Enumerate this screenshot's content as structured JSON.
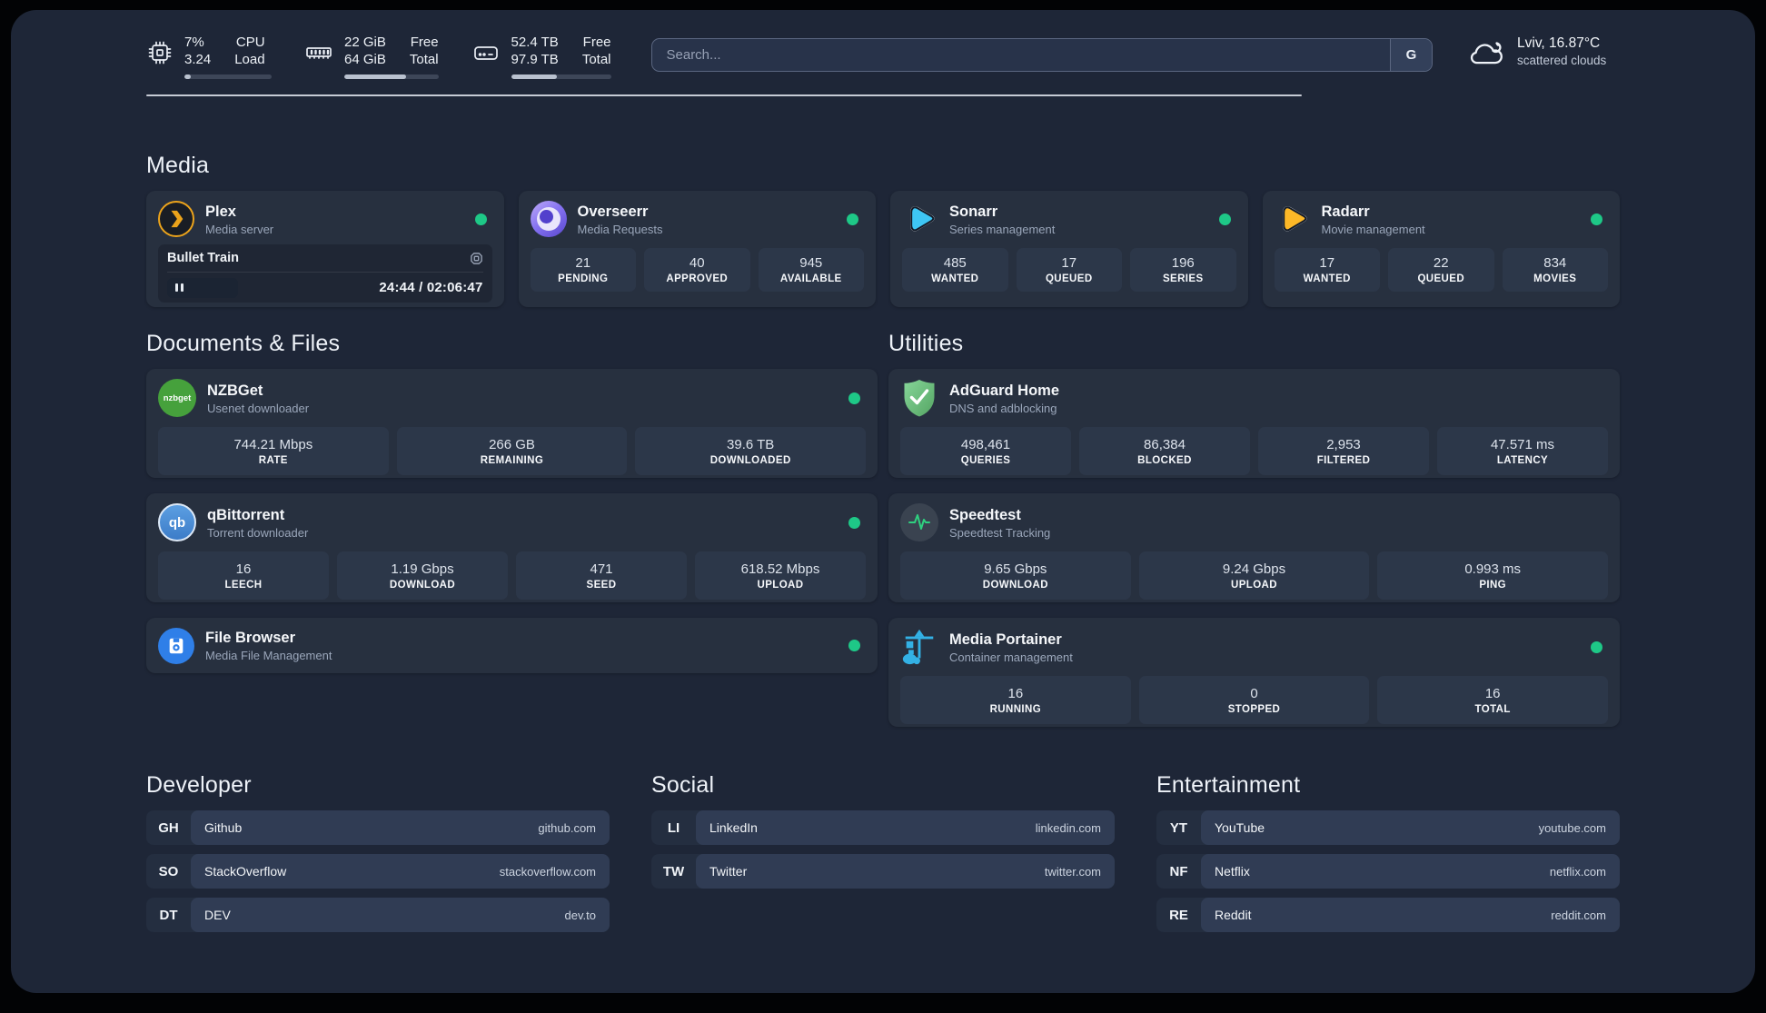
{
  "colors": {
    "status_online": "#1ec887",
    "accent_plex": "#eba31b",
    "accent_green": "#2fd180"
  },
  "header": {
    "stats": [
      {
        "icon": "cpu-icon",
        "value1": "7%",
        "value2": "3.24",
        "label1": "CPU",
        "label2": "Load",
        "used_pct": 7
      },
      {
        "icon": "memory-icon",
        "value1": "22 GiB",
        "value2": "64 GiB",
        "label1": "Free",
        "label2": "Total",
        "used_pct": 66
      },
      {
        "icon": "disk-icon",
        "value1": "52.4 TB",
        "value2": "97.9 TB",
        "label1": "Free",
        "label2": "Total",
        "used_pct": 46
      }
    ],
    "search": {
      "placeholder": "Search...",
      "engine_button": "G"
    },
    "weather": {
      "line1": "Lviv, 16.87°C",
      "line2": "scattered clouds"
    }
  },
  "media": {
    "title": "Media",
    "plex": {
      "name": "Plex",
      "subtitle": "Media server",
      "now_playing": "Bullet Train",
      "time": "24:44 / 02:06:47",
      "progress_pct": 19
    },
    "overseerr": {
      "name": "Overseerr",
      "subtitle": "Media Requests",
      "stats": [
        {
          "value": "21",
          "label": "PENDING"
        },
        {
          "value": "40",
          "label": "APPROVED"
        },
        {
          "value": "945",
          "label": "AVAILABLE"
        }
      ]
    },
    "sonarr": {
      "name": "Sonarr",
      "subtitle": "Series management",
      "stats": [
        {
          "value": "485",
          "label": "WANTED"
        },
        {
          "value": "17",
          "label": "QUEUED"
        },
        {
          "value": "196",
          "label": "SERIES"
        }
      ]
    },
    "radarr": {
      "name": "Radarr",
      "subtitle": "Movie management",
      "stats": [
        {
          "value": "17",
          "label": "WANTED"
        },
        {
          "value": "22",
          "label": "QUEUED"
        },
        {
          "value": "834",
          "label": "MOVIES"
        }
      ]
    }
  },
  "documents": {
    "title": "Documents & Files",
    "nzbget": {
      "name": "NZBGet",
      "subtitle": "Usenet downloader",
      "icon_text": "nzbget",
      "stats": [
        {
          "value": "744.21 Mbps",
          "label": "RATE"
        },
        {
          "value": "266 GB",
          "label": "REMAINING"
        },
        {
          "value": "39.6 TB",
          "label": "DOWNLOADED"
        }
      ]
    },
    "qbittorrent": {
      "name": "qBittorrent",
      "subtitle": "Torrent downloader",
      "icon_text": "qb",
      "stats": [
        {
          "value": "16",
          "label": "LEECH"
        },
        {
          "value": "1.19 Gbps",
          "label": "DOWNLOAD"
        },
        {
          "value": "471",
          "label": "SEED"
        },
        {
          "value": "618.52 Mbps",
          "label": "UPLOAD"
        }
      ]
    },
    "filebrowser": {
      "name": "File Browser",
      "subtitle": "Media File Management"
    }
  },
  "utilities": {
    "title": "Utilities",
    "adguard": {
      "name": "AdGuard Home",
      "subtitle": "DNS and adblocking",
      "stats": [
        {
          "value": "498,461",
          "label": "QUERIES"
        },
        {
          "value": "86,384",
          "label": "BLOCKED"
        },
        {
          "value": "2,953",
          "label": "FILTERED"
        },
        {
          "value": "47.571 ms",
          "label": "LATENCY"
        }
      ]
    },
    "speedtest": {
      "name": "Speedtest",
      "subtitle": "Speedtest Tracking",
      "stats": [
        {
          "value": "9.65 Gbps",
          "label": "DOWNLOAD"
        },
        {
          "value": "9.24 Gbps",
          "label": "UPLOAD"
        },
        {
          "value": "0.993 ms",
          "label": "PING"
        }
      ]
    },
    "portainer": {
      "name": "Media Portainer",
      "subtitle": "Container management",
      "stats": [
        {
          "value": "16",
          "label": "RUNNING"
        },
        {
          "value": "0",
          "label": "STOPPED"
        },
        {
          "value": "16",
          "label": "TOTAL"
        }
      ]
    }
  },
  "bookmarks": [
    {
      "title": "Developer",
      "links": [
        {
          "abbr": "GH",
          "name": "Github",
          "url": "github.com"
        },
        {
          "abbr": "SO",
          "name": "StackOverflow",
          "url": "stackoverflow.com"
        },
        {
          "abbr": "DT",
          "name": "DEV",
          "url": "dev.to"
        }
      ]
    },
    {
      "title": "Social",
      "links": [
        {
          "abbr": "LI",
          "name": "LinkedIn",
          "url": "linkedin.com"
        },
        {
          "abbr": "TW",
          "name": "Twitter",
          "url": "twitter.com"
        }
      ]
    },
    {
      "title": "Entertainment",
      "links": [
        {
          "abbr": "YT",
          "name": "YouTube",
          "url": "youtube.com"
        },
        {
          "abbr": "NF",
          "name": "Netflix",
          "url": "netflix.com"
        },
        {
          "abbr": "RE",
          "name": "Reddit",
          "url": "reddit.com"
        }
      ]
    }
  ]
}
